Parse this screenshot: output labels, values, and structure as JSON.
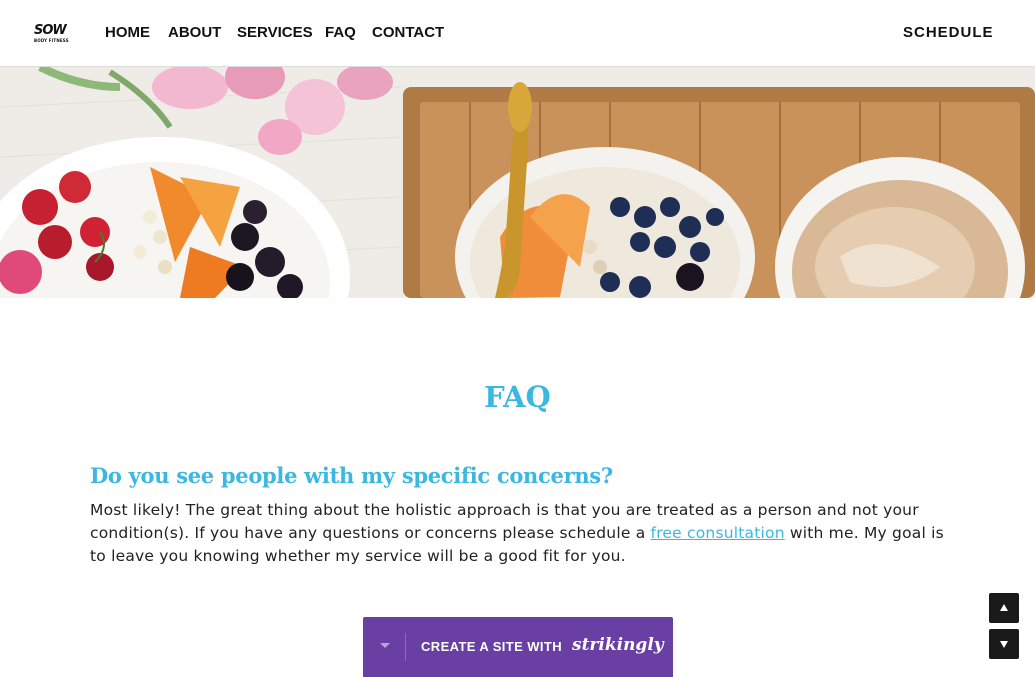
{
  "nav": {
    "logo_text": "SOW",
    "logo_tagline": "BODY FITNESS",
    "links": [
      "HOME",
      "ABOUT",
      "SERVICES",
      "FAQ",
      "CONTACT"
    ],
    "schedule_label": "SCHEDULE"
  },
  "faq": {
    "title": "FAQ",
    "question": "Do you see people with my specific concerns?",
    "answer_before": "Most likely! The great thing about the holistic approach is that you are treated as a person and not your condition(s). If you have any questions or concerns please schedule a ",
    "answer_link": "free consultation",
    "answer_after": " with me. My goal is to leave you knowing whether my service will be a good fit for you."
  },
  "badge": {
    "label": "CREATE A SITE WITH",
    "brand": "strikingly"
  },
  "colors": {
    "accent": "#3bb8e0",
    "badge": "#6a3fa3"
  }
}
